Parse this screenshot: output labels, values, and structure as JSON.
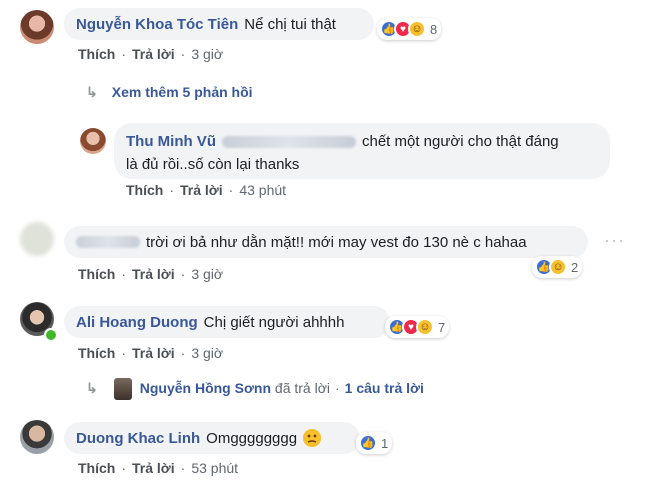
{
  "actions": {
    "like": "Thích",
    "reply": "Trả lời"
  },
  "comments": [
    {
      "name": "Nguyễn Khoa Tóc Tiên",
      "text": "Nể chị tui thật",
      "time": "3 giờ",
      "reaction_count": "8"
    },
    {
      "name": "Thu Minh Vũ",
      "text_line1": "chết một người cho thật đáng",
      "text_line2": "là đủ rồi..số còn lại thanks",
      "time": "43 phút"
    },
    {
      "text": "trời ơi bả như dằn mặt!! mới may vest đo 130 nè c hahaa",
      "time": "3 giờ",
      "reaction_count": "2"
    },
    {
      "name": "Ali Hoang Duong",
      "text": "Chị giết người ahhhh",
      "time": "3 giờ",
      "reaction_count": "7"
    },
    {
      "name": "Duong Khac Linh",
      "text": "Omgggggggg",
      "time": "53 phút",
      "reaction_count": "1"
    }
  ],
  "more_replies": "Xem thêm 5 phản hồi",
  "reply_summary": {
    "name": "Nguyễn Hồng Sơnn",
    "text": "đã trả lời",
    "count": "1 câu trả lời"
  },
  "colors": {
    "link": "#385898",
    "bubble": "#f2f3f5",
    "like": "#3b6fd6",
    "love": "#f0284a",
    "haha": "#f7c02e"
  },
  "icons": [
    "reply-arrow-icon",
    "like-reaction-icon",
    "love-reaction-icon",
    "haha-reaction-icon",
    "more-options-icon",
    "confused-emoji-icon"
  ]
}
